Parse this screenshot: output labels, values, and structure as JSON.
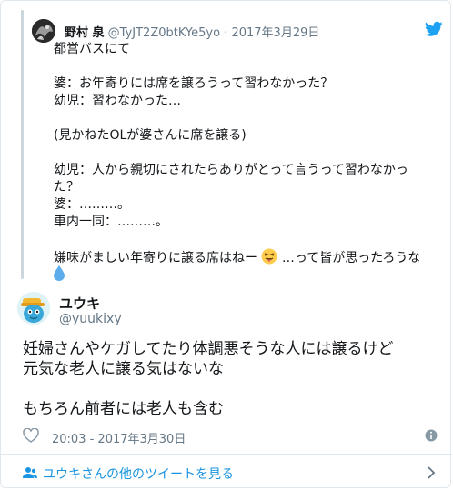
{
  "quoted_tweet": {
    "author_name": "野村 泉",
    "author_handle": "@TyJT2Z0btKYe5yo",
    "separator": "·",
    "date": "2017年3月29日",
    "lines": [
      "都営バスにて",
      "",
      "婆：お年寄りには席を譲ろうって習わなかった？",
      "幼児：習わなかった…",
      "",
      "(見かねたOLが婆さんに席を譲る)",
      "",
      "幼児：人から親切にされたらありがとって言うって習わなかっ",
      "た？",
      "婆：………。",
      "車内一同：………。",
      "",
      "嫌味がましい年寄りに譲る席はねー",
      ""
    ],
    "last_line_suffix": "…って皆が思ったろうな",
    "icons": [
      "twitter-bird-icon",
      "tongue-wink-emoji",
      "droplet-emoji"
    ]
  },
  "tweet": {
    "author_name": "ユウキ",
    "author_handle": "@yuukixy",
    "body_lines": [
      "妊婦さんやケガしてたり体調悪そうな人には譲るけど",
      "元気な老人に譲る気はないな",
      "",
      "もちろん前者には老人も含む"
    ],
    "timestamp": "20:03 - 2017年3月30日"
  },
  "footer": {
    "label": "ユウキさんの他のツイートを見る"
  },
  "colors": {
    "link": "#1b95e0",
    "muted": "#657786",
    "twitter_blue": "#1da1f2",
    "border": "#e1e8ed"
  }
}
